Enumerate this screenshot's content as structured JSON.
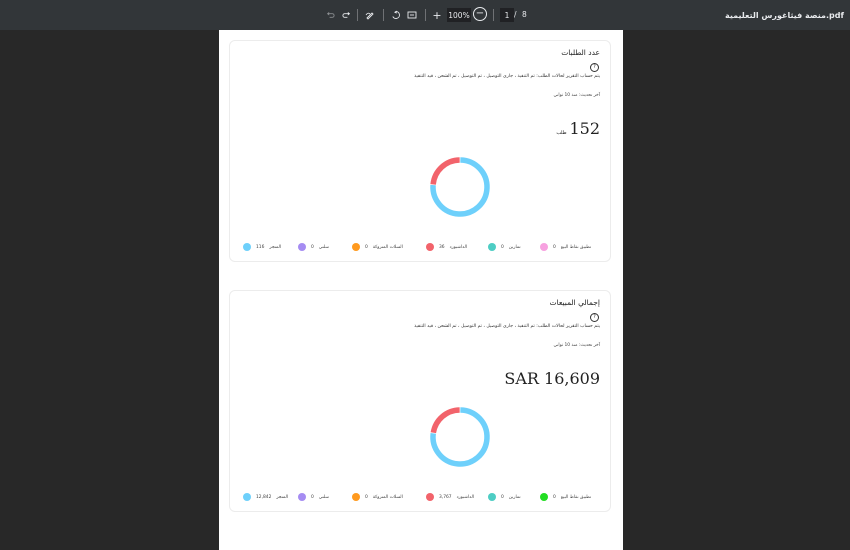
{
  "toolbar": {
    "filename": "منصة فيثاغورس التعليمية.pdf",
    "zoom": "100%",
    "current_page": "1",
    "page_separator": "/",
    "total_pages": "8",
    "zoom_in_label": "+",
    "zoom_out_label": "−"
  },
  "cards": [
    {
      "title": "عدد الطلبات",
      "help_label": "?",
      "description": "يتم حساب التقرير لحالات الطلب: تم التنفيذ ، جاري التوصيل ، تم التوصيل ، تم الشحن ، قيد التنفيذ",
      "updated": "آخر تحديث: منذ 10 ثواني",
      "value": "152",
      "unit": "طلب",
      "donut": [
        {
          "label": "المتجر",
          "value": 116,
          "color": "#6ed0fb"
        },
        {
          "label": "الداشبورد",
          "value": 36,
          "color": "#f2636b"
        }
      ],
      "legend": [
        {
          "value": "116",
          "label": "المتجر",
          "color": "#6ed0fb"
        },
        {
          "value": "0",
          "label": "سلتي",
          "color": "#a58cf2"
        },
        {
          "value": "0",
          "label": "السلات المتروكة",
          "color": "#ff9a1f"
        },
        {
          "value": "36",
          "label": "الداشبورد",
          "color": "#f2636b"
        },
        {
          "value": "0",
          "label": "تمارين",
          "color": "#4ecdc4"
        },
        {
          "value": "0",
          "label": "تطبيق نقاط البيع",
          "color": "#f7a1e0"
        }
      ]
    },
    {
      "title": "إجمالي المبيعات",
      "help_label": "?",
      "description": "يتم حساب التقرير لحالات الطلب: تم التنفيذ ، جاري التوصيل ، تم التوصيل ، تم الشحن ، قيد التنفيذ",
      "updated": "آخر تحديث: منذ 10 ثواني",
      "value": "SAR 16,609",
      "unit": "",
      "donut": [
        {
          "label": "المتجر",
          "value": 12842,
          "color": "#6ed0fb"
        },
        {
          "label": "الداشبورد",
          "value": 3767,
          "color": "#f2636b"
        }
      ],
      "legend": [
        {
          "value": "12,842",
          "label": "المتجر",
          "color": "#6ed0fb"
        },
        {
          "value": "0",
          "label": "سلتي",
          "color": "#a58cf2"
        },
        {
          "value": "0",
          "label": "السلات المتروكة",
          "color": "#ff9a1f"
        },
        {
          "value": "3,767",
          "label": "الداشبورد",
          "color": "#f2636b"
        },
        {
          "value": "0",
          "label": "تمارين",
          "color": "#4ecdc4"
        },
        {
          "value": "0",
          "label": "تطبيق نقاط البيع",
          "color": "#22dd22"
        }
      ]
    }
  ]
}
